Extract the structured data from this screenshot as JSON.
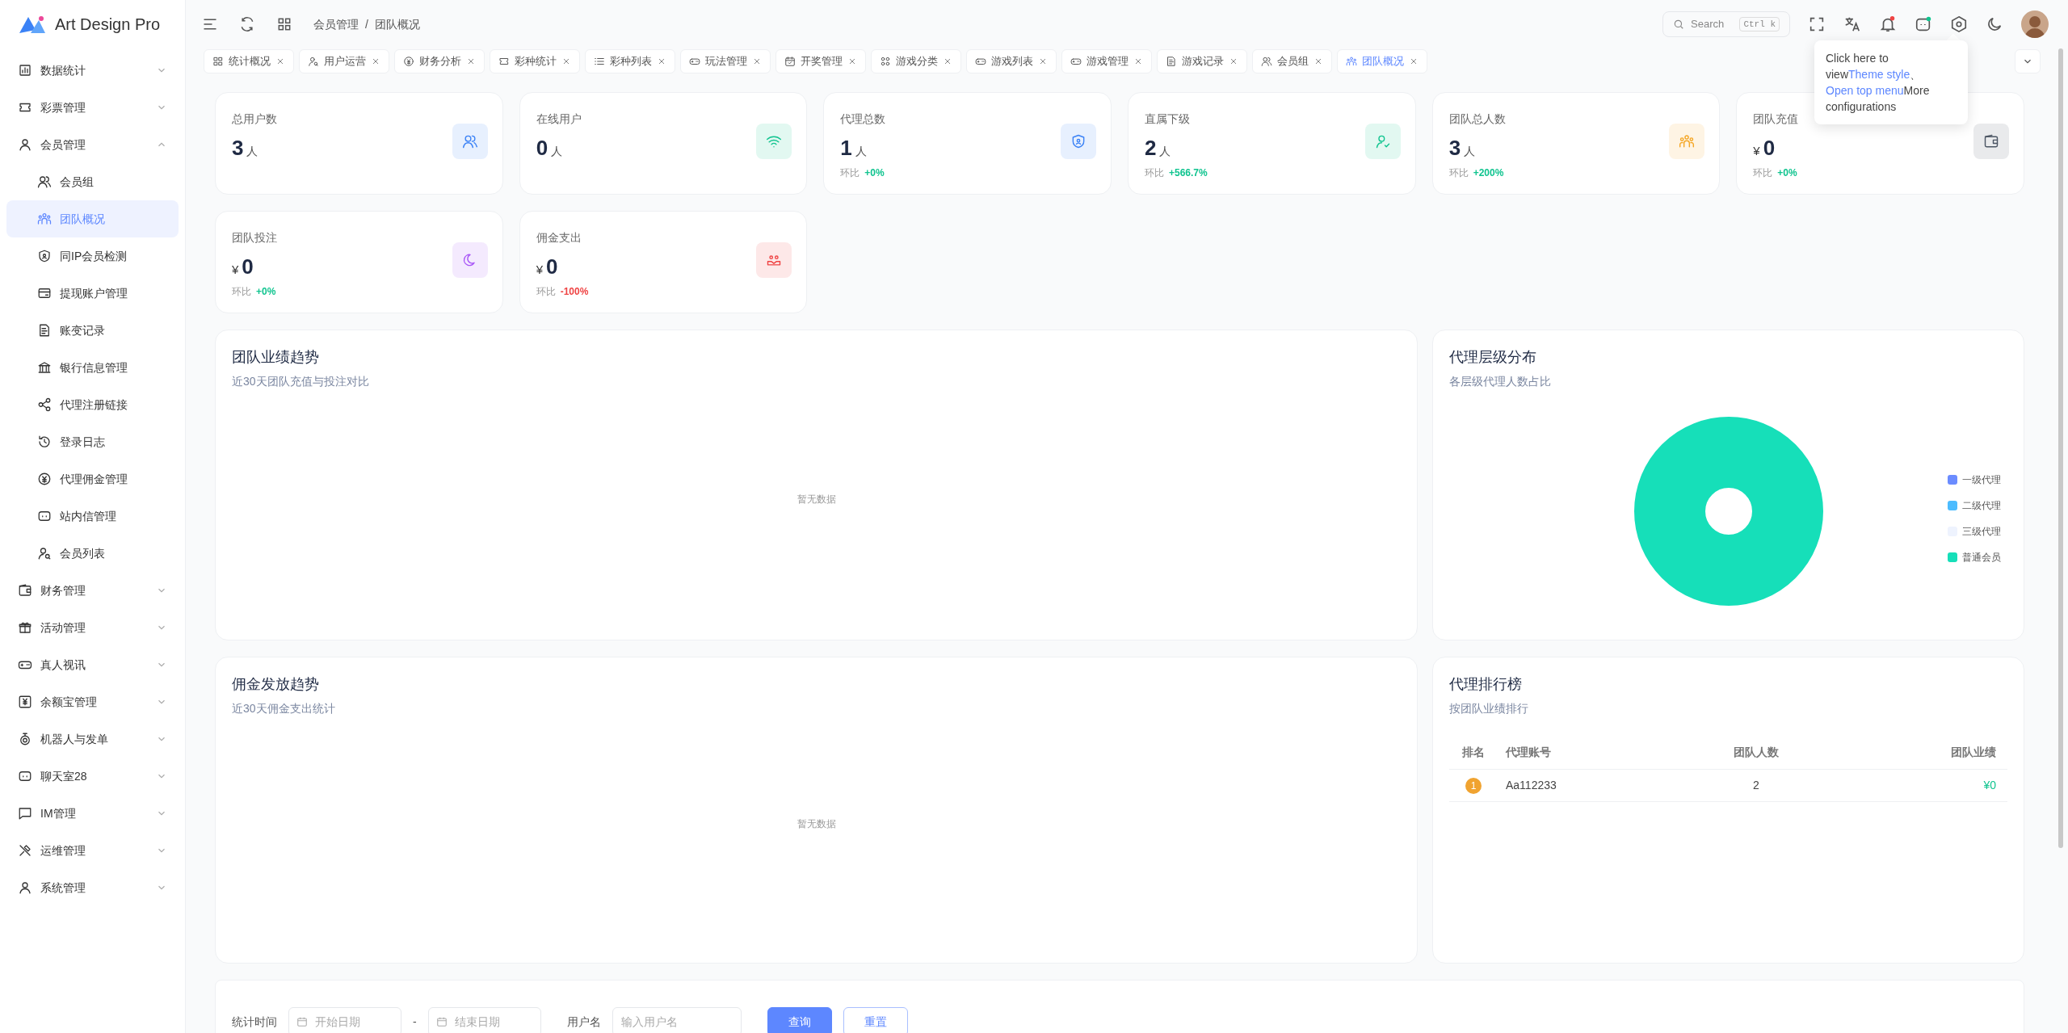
{
  "brand": {
    "name": "Art Design Pro"
  },
  "sidebar": {
    "items": [
      {
        "label": "数据统计",
        "expanded": false,
        "selected": false
      },
      {
        "label": "彩票管理",
        "expanded": false,
        "selected": false
      },
      {
        "label": "会员管理",
        "expanded": true,
        "selected": false,
        "children": [
          {
            "label": "会员组",
            "selected": false
          },
          {
            "label": "团队概况",
            "selected": true
          },
          {
            "label": "同IP会员检测",
            "selected": false
          },
          {
            "label": "提现账户管理",
            "selected": false
          },
          {
            "label": "账变记录",
            "selected": false
          },
          {
            "label": "银行信息管理",
            "selected": false
          },
          {
            "label": "代理注册链接",
            "selected": false
          },
          {
            "label": "登录日志",
            "selected": false
          },
          {
            "label": "代理佣金管理",
            "selected": false
          },
          {
            "label": "站内信管理",
            "selected": false
          },
          {
            "label": "会员列表",
            "selected": false
          }
        ]
      },
      {
        "label": "财务管理",
        "expanded": false,
        "selected": false
      },
      {
        "label": "活动管理",
        "expanded": false,
        "selected": false
      },
      {
        "label": "真人视讯",
        "expanded": false,
        "selected": false
      },
      {
        "label": "余额宝管理",
        "expanded": false,
        "selected": false
      },
      {
        "label": "机器人与发单",
        "expanded": false,
        "selected": false
      },
      {
        "label": "聊天室28",
        "expanded": false,
        "selected": false
      },
      {
        "label": "IM管理",
        "expanded": false,
        "selected": false
      },
      {
        "label": "运维管理",
        "expanded": false,
        "selected": false
      },
      {
        "label": "系统管理",
        "expanded": false,
        "selected": false
      }
    ]
  },
  "breadcrumb": [
    "会员管理",
    "/",
    "团队概况"
  ],
  "search": {
    "placeholder": "Search",
    "shortcut_mod": "Ctrl",
    "shortcut_key": "k"
  },
  "tabs": [
    {
      "label": "统计概况",
      "selected": false
    },
    {
      "label": "用户运营",
      "selected": false
    },
    {
      "label": "财务分析",
      "selected": false
    },
    {
      "label": "彩种统计",
      "selected": false
    },
    {
      "label": "彩种列表",
      "selected": false
    },
    {
      "label": "玩法管理",
      "selected": false
    },
    {
      "label": "开奖管理",
      "selected": false
    },
    {
      "label": "游戏分类",
      "selected": false
    },
    {
      "label": "游戏列表",
      "selected": false
    },
    {
      "label": "游戏管理",
      "selected": false
    },
    {
      "label": "游戏记录",
      "selected": false
    },
    {
      "label": "会员组",
      "selected": false
    },
    {
      "label": "团队概况",
      "selected": true
    }
  ],
  "tooltip": {
    "parts": [
      {
        "text": "Click here to view",
        "link": false
      },
      {
        "text": "Theme style",
        "link": true
      },
      {
        "text": "、 ",
        "link": false
      },
      {
        "text": "Open top menu",
        "link": true
      },
      {
        "text": "More configurations",
        "link": false
      }
    ]
  },
  "cards": [
    {
      "label": "总用户数",
      "value": "3",
      "unit": "人",
      "color": "#3b82f6"
    },
    {
      "label": "在线用户",
      "value": "0",
      "unit": "人",
      "color": "#10c48f"
    },
    {
      "label": "代理总数",
      "value": "1",
      "unit": "人",
      "color": "#3b82f6",
      "change_label": "环比",
      "change": "+0%"
    },
    {
      "label": "直属下级",
      "value": "2",
      "unit": "人",
      "color": "#10c48f",
      "change_label": "环比",
      "change": "+566.7%"
    },
    {
      "label": "团队总人数",
      "value": "3",
      "unit": "人",
      "color": "#f5a623",
      "change_label": "环比",
      "change": "+200%"
    },
    {
      "label": "团队充值",
      "prefix": "¥",
      "value": "0",
      "color": "#4b5563",
      "change_label": "环比",
      "change": "+0%"
    },
    {
      "label": "团队投注",
      "prefix": "¥",
      "value": "0",
      "color": "#a855f7",
      "change_label": "环比",
      "change": "+0%"
    },
    {
      "label": "佣金支出",
      "prefix": "¥",
      "value": "0",
      "color": "#ef4444",
      "change_label": "环比",
      "change": "-100%"
    }
  ],
  "performance_trend": {
    "title": "团队业绩趋势",
    "subtitle": "近30天团队充值与投注对比",
    "empty_text": "暂无数据"
  },
  "agent_levels": {
    "title": "代理层级分布",
    "subtitle": "各层级代理人数占比",
    "legend": [
      {
        "label": "一级代理",
        "color": "#6b8cff"
      },
      {
        "label": "二级代理",
        "color": "#4cbcff"
      },
      {
        "label": "三级代理",
        "color": "#eef3fe"
      },
      {
        "label": "普通会员",
        "color": "#16dfb9"
      }
    ]
  },
  "commission_trend": {
    "title": "佣金发放趋势",
    "subtitle": "近30天佣金支出统计",
    "empty_text": "暂无数据"
  },
  "ranking": {
    "title": "代理排行榜",
    "subtitle": "按团队业绩排行",
    "columns": [
      "排名",
      "代理账号",
      "团队人数",
      "团队业绩"
    ],
    "rows": [
      {
        "rank": "1",
        "account": "Aa112233",
        "team_size": "2",
        "performance": "¥0"
      }
    ]
  },
  "filter": {
    "time_label": "统计时间",
    "start_placeholder": "开始日期",
    "separator": "-",
    "end_placeholder": "结束日期",
    "user_label": "用户名",
    "user_placeholder": "输入用户名",
    "buttons": [
      {
        "label": "查询",
        "kind": "primary"
      },
      {
        "label": "重置",
        "kind": "outline"
      }
    ]
  }
}
